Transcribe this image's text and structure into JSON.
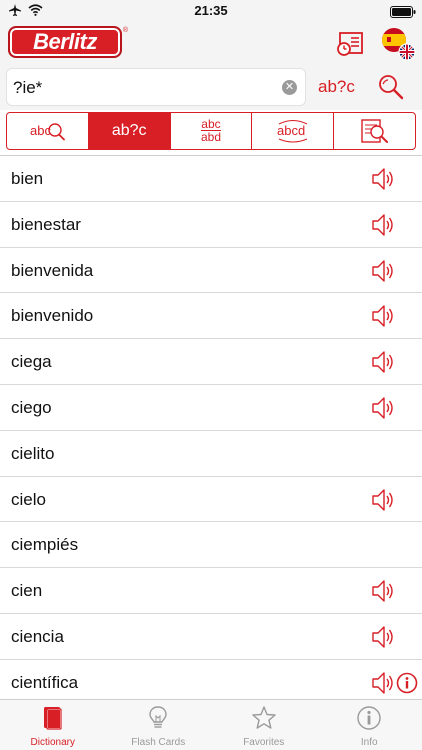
{
  "status_bar": {
    "time": "21:35"
  },
  "header": {
    "logo_text": "Berlitz",
    "logo_mark": "®",
    "history_icon": "history-list-icon",
    "language_flags": [
      "spain-flag",
      "uk-flag"
    ]
  },
  "search": {
    "value": "?ie*",
    "placeholder": "",
    "mode_label": "ab?c"
  },
  "segments": [
    {
      "name": "fuzzy-search",
      "icon": "spell-search-icon",
      "top": "abc",
      "bottom": ""
    },
    {
      "name": "wildcard-search",
      "label": "ab?c",
      "active": true
    },
    {
      "name": "spelling-variants",
      "top": "abc",
      "bottom": "abd"
    },
    {
      "name": "anagram-search",
      "label": "abcd"
    },
    {
      "name": "full-text-search",
      "icon": "document-search-icon"
    }
  ],
  "words": [
    {
      "text": "bien",
      "audio": true
    },
    {
      "text": "bienestar",
      "audio": true
    },
    {
      "text": "bienvenida",
      "audio": true
    },
    {
      "text": "bienvenido",
      "audio": true
    },
    {
      "text": "ciega",
      "audio": true
    },
    {
      "text": "ciego",
      "audio": true
    },
    {
      "text": "cielito",
      "audio": false
    },
    {
      "text": "cielo",
      "audio": true
    },
    {
      "text": "ciempiés",
      "audio": false
    },
    {
      "text": "cien",
      "audio": true
    },
    {
      "text": "ciencia",
      "audio": true
    },
    {
      "text": "científica",
      "audio": true,
      "info": true
    }
  ],
  "tabs": [
    {
      "label": "Dictionary",
      "icon": "book-icon",
      "active": true
    },
    {
      "label": "Flash Cards",
      "icon": "lightbulb-icon",
      "active": false
    },
    {
      "label": "Favorites",
      "icon": "star-icon",
      "active": false
    },
    {
      "label": "Info",
      "icon": "info-icon",
      "active": false
    }
  ],
  "colors": {
    "accent": "#d81f26",
    "inactive": "#9a9a9a"
  }
}
